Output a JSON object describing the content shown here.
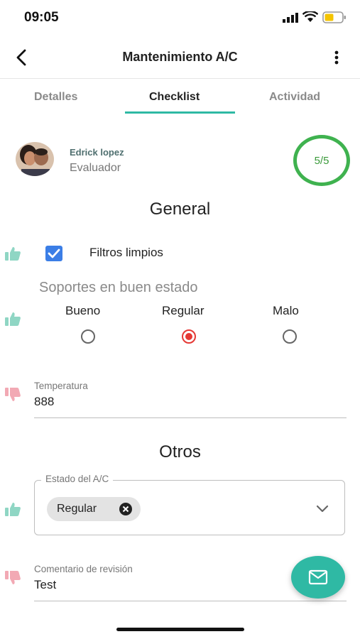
{
  "status_bar": {
    "time": "09:05"
  },
  "header": {
    "title": "Mantenimiento A/C"
  },
  "tabs": [
    {
      "label": "Detalles",
      "active": false
    },
    {
      "label": "Checklist",
      "active": true
    },
    {
      "label": "Actividad",
      "active": false
    }
  ],
  "evaluator": {
    "name": "Edrick lopez",
    "role": "Evaluador",
    "score": "5/5"
  },
  "general": {
    "title": "General",
    "filters": {
      "label": "Filtros limpios",
      "checked": true
    },
    "supports": {
      "question": "Soportes en buen estado",
      "options": [
        "Bueno",
        "Regular",
        "Malo"
      ],
      "selected": "Regular"
    },
    "temperature": {
      "label": "Temperatura",
      "value": "888"
    }
  },
  "others": {
    "title": "Otros",
    "ac_state": {
      "label": "Estado del A/C",
      "chip": "Regular"
    },
    "comment": {
      "label": "Comentario de revisión",
      "value": "Test"
    }
  },
  "colors": {
    "accent": "#2fb9a4",
    "score_ring": "#3fb24f",
    "radio_selected": "#e53935",
    "checkbox": "#3b7ee6"
  }
}
